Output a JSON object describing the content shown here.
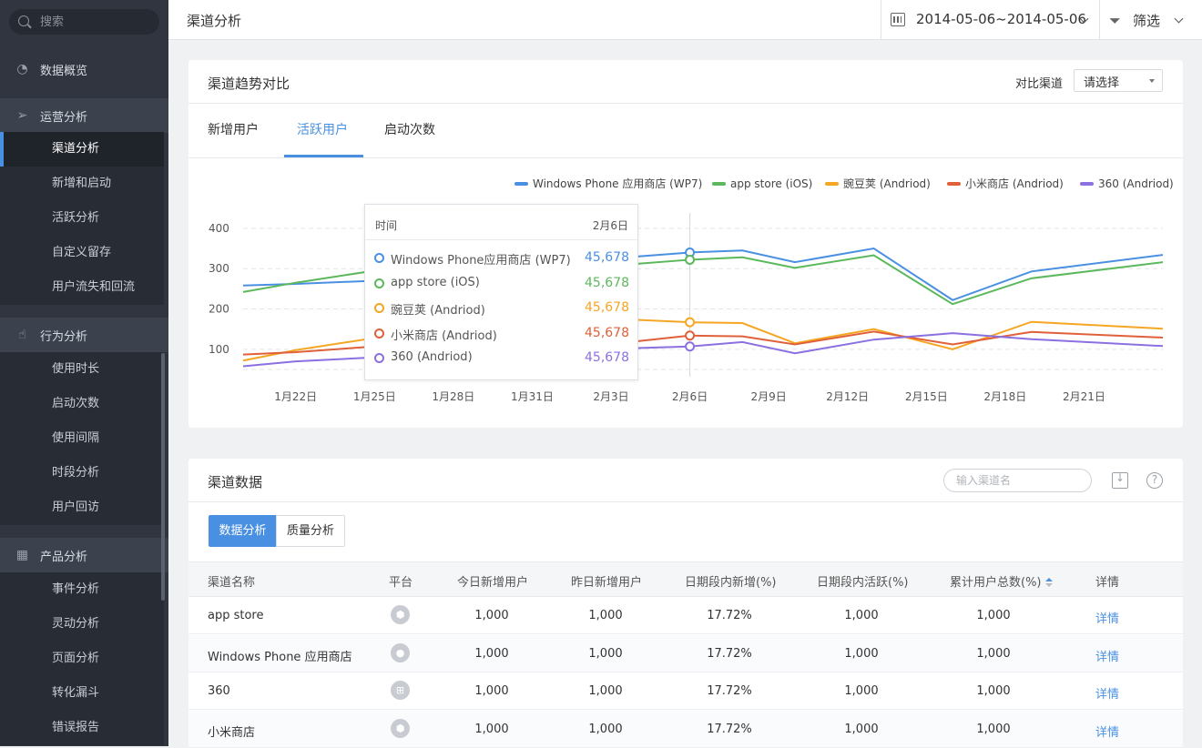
{
  "sidebar": {
    "search_placeholder": "搜索",
    "overview": "数据概览",
    "sections": [
      {
        "label": "运营分析",
        "items": [
          "渠道分析",
          "新增和启动",
          "活跃分析",
          "自定义留存",
          "用户流失和回流"
        ]
      },
      {
        "label": "行为分析",
        "items": [
          "使用时长",
          "启动次数",
          "使用间隔",
          "时段分析",
          "用户回访"
        ]
      },
      {
        "label": "产品分析",
        "items": [
          "事件分析",
          "灵动分析",
          "页面分析",
          "转化漏斗",
          "错误报告"
        ]
      }
    ]
  },
  "topbar": {
    "title": "渠道分析",
    "date_range": "2014-05-06~2014-05-06",
    "filter_label": "筛选"
  },
  "trend": {
    "title": "渠道趋势对比",
    "compare_label": "对比渠道",
    "compare_select": "请选择",
    "tabs": [
      "新增用户",
      "活跃用户",
      "启动次数"
    ],
    "active_tab": 1
  },
  "tooltip": {
    "header_label": "时间",
    "header_date": "2月6日",
    "rows": [
      {
        "name": "Windows Phone应用商店 (WP7)",
        "value": "45,678",
        "color": "#4a90e2"
      },
      {
        "name": "app store (iOS)",
        "value": "45,678",
        "color": "#5cb85c"
      },
      {
        "name": "豌豆荚 (Andriod)",
        "value": "45,678",
        "color": "#f5a623"
      },
      {
        "name": "小米商店 (Andriod)",
        "value": "45,678",
        "color": "#e0603a"
      },
      {
        "name": "360 (Andriod)",
        "value": "45,678",
        "color": "#8c6fe0"
      }
    ]
  },
  "chart_data": {
    "type": "line",
    "x": [
      "1月20日",
      "1月22日",
      "1月25日",
      "1月28日",
      "1月31日",
      "2月3日",
      "2月4日",
      "2月6日",
      "2月8日",
      "2月10日",
      "2月13日",
      "2月16日",
      "2月19日",
      "2月24日"
    ],
    "xticks": [
      "1月22日",
      "1月25日",
      "1月28日",
      "1月31日",
      "2月3日",
      "2月6日",
      "2月9日",
      "2月12日",
      "2月15日",
      "2月18日",
      "2月21日"
    ],
    "yticks": [
      100,
      200,
      300,
      400
    ],
    "ylim": [
      50,
      420
    ],
    "series": [
      {
        "name": "Windows Phone 应用商店 (WP7)",
        "color": "#4a90e2",
        "values": [
          258,
          262,
          270,
          310,
          320,
          305,
          330,
          340,
          345,
          316,
          350,
          222,
          293,
          334
        ]
      },
      {
        "name": "app store (iOS)",
        "color": "#5cb85c",
        "values": [
          242,
          265,
          295,
          300,
          300,
          298,
          312,
          322,
          328,
          302,
          333,
          212,
          276,
          316
        ]
      },
      {
        "name": "豌豆荚 (Andriod)",
        "color": "#f5a623",
        "values": [
          72,
          98,
          128,
          142,
          160,
          162,
          173,
          167,
          165,
          115,
          150,
          100,
          168,
          151
        ]
      },
      {
        "name": "小米商店 (Andriod)",
        "color": "#e0603a",
        "values": [
          87,
          93,
          107,
          120,
          140,
          130,
          120,
          134,
          132,
          112,
          144,
          112,
          143,
          129
        ]
      },
      {
        "name": "360 (Andriod)",
        "color": "#8c6fe0",
        "values": [
          58,
          70,
          80,
          110,
          125,
          95,
          103,
          107,
          118,
          90,
          124,
          140,
          125,
          108
        ]
      }
    ],
    "highlight_index": 7,
    "grid": true,
    "legend": "top-right"
  },
  "table": {
    "title": "渠道数据",
    "search_placeholder": "输入渠道名",
    "segments": [
      "数据分析",
      "质量分析"
    ],
    "columns": [
      "渠道名称",
      "平台",
      "今日新增用户",
      "昨日新增用户",
      "日期段内新增(%)",
      "日期段内活跃(%)",
      "累计用户总数(%)",
      "详情"
    ],
    "rows": [
      {
        "name": "app store",
        "platform": "android-icon",
        "today": "1,000",
        "yesterday": "1,000",
        "period_new": "17.72%",
        "period_active": "1,000",
        "total": "1,000",
        "detail": "详情"
      },
      {
        "name": "Windows Phone 应用商店",
        "platform": "apple-icon",
        "today": "1,000",
        "yesterday": "1,000",
        "period_new": "17.72%",
        "period_active": "1,000",
        "total": "1,000",
        "detail": "详情"
      },
      {
        "name": "360",
        "platform": "windows-icon",
        "today": "1,000",
        "yesterday": "1,000",
        "period_new": "17.72%",
        "period_active": "1,000",
        "total": "1,000",
        "detail": "详情"
      },
      {
        "name": "小米商店",
        "platform": "android-icon",
        "today": "1,000",
        "yesterday": "1,000",
        "period_new": "17.72%",
        "period_active": "1,000",
        "total": "1,000",
        "detail": "详情"
      }
    ]
  },
  "colors": {
    "accent": "#4a90e2",
    "sidebar_bg": "#30353f"
  }
}
